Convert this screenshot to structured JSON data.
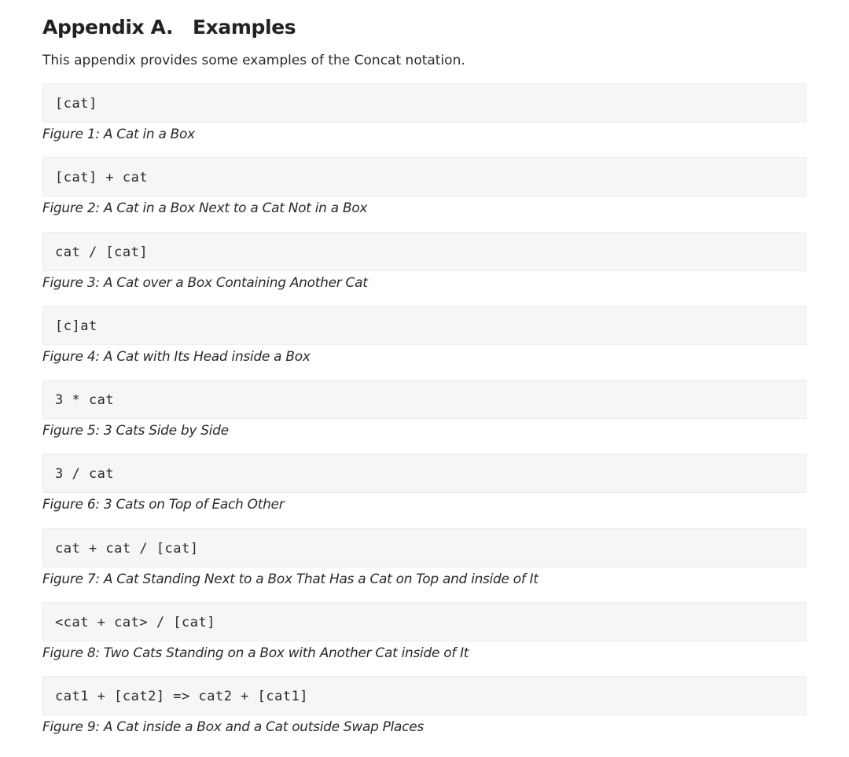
{
  "section": {
    "title": "Appendix A.   Examples",
    "intro": "This appendix provides some examples of the Concat notation."
  },
  "figures": [
    {
      "code": "[cat]",
      "caption": "Figure 1: A Cat in a Box"
    },
    {
      "code": "[cat] + cat",
      "caption": "Figure 2: A Cat in a Box Next to a Cat Not in a Box"
    },
    {
      "code": "cat / [cat]",
      "caption": "Figure 3: A Cat over a Box Containing Another Cat"
    },
    {
      "code": "[c]at",
      "caption": "Figure 4: A Cat with Its Head inside a Box"
    },
    {
      "code": "3 * cat",
      "caption": "Figure 5: 3 Cats Side by Side"
    },
    {
      "code": "3 / cat",
      "caption": "Figure 6: 3 Cats on Top of Each Other"
    },
    {
      "code": "cat + cat / [cat]",
      "caption": "Figure 7: A Cat Standing Next to a Box That Has a Cat on Top and inside of It"
    },
    {
      "code": "<cat + cat> / [cat]",
      "caption": "Figure 8: Two Cats Standing on a Box with Another Cat inside of It"
    },
    {
      "code": "cat1 + [cat2] => cat2 + [cat1]",
      "caption": "Figure 9: A Cat inside a Box and a Cat outside Swap Places"
    }
  ]
}
